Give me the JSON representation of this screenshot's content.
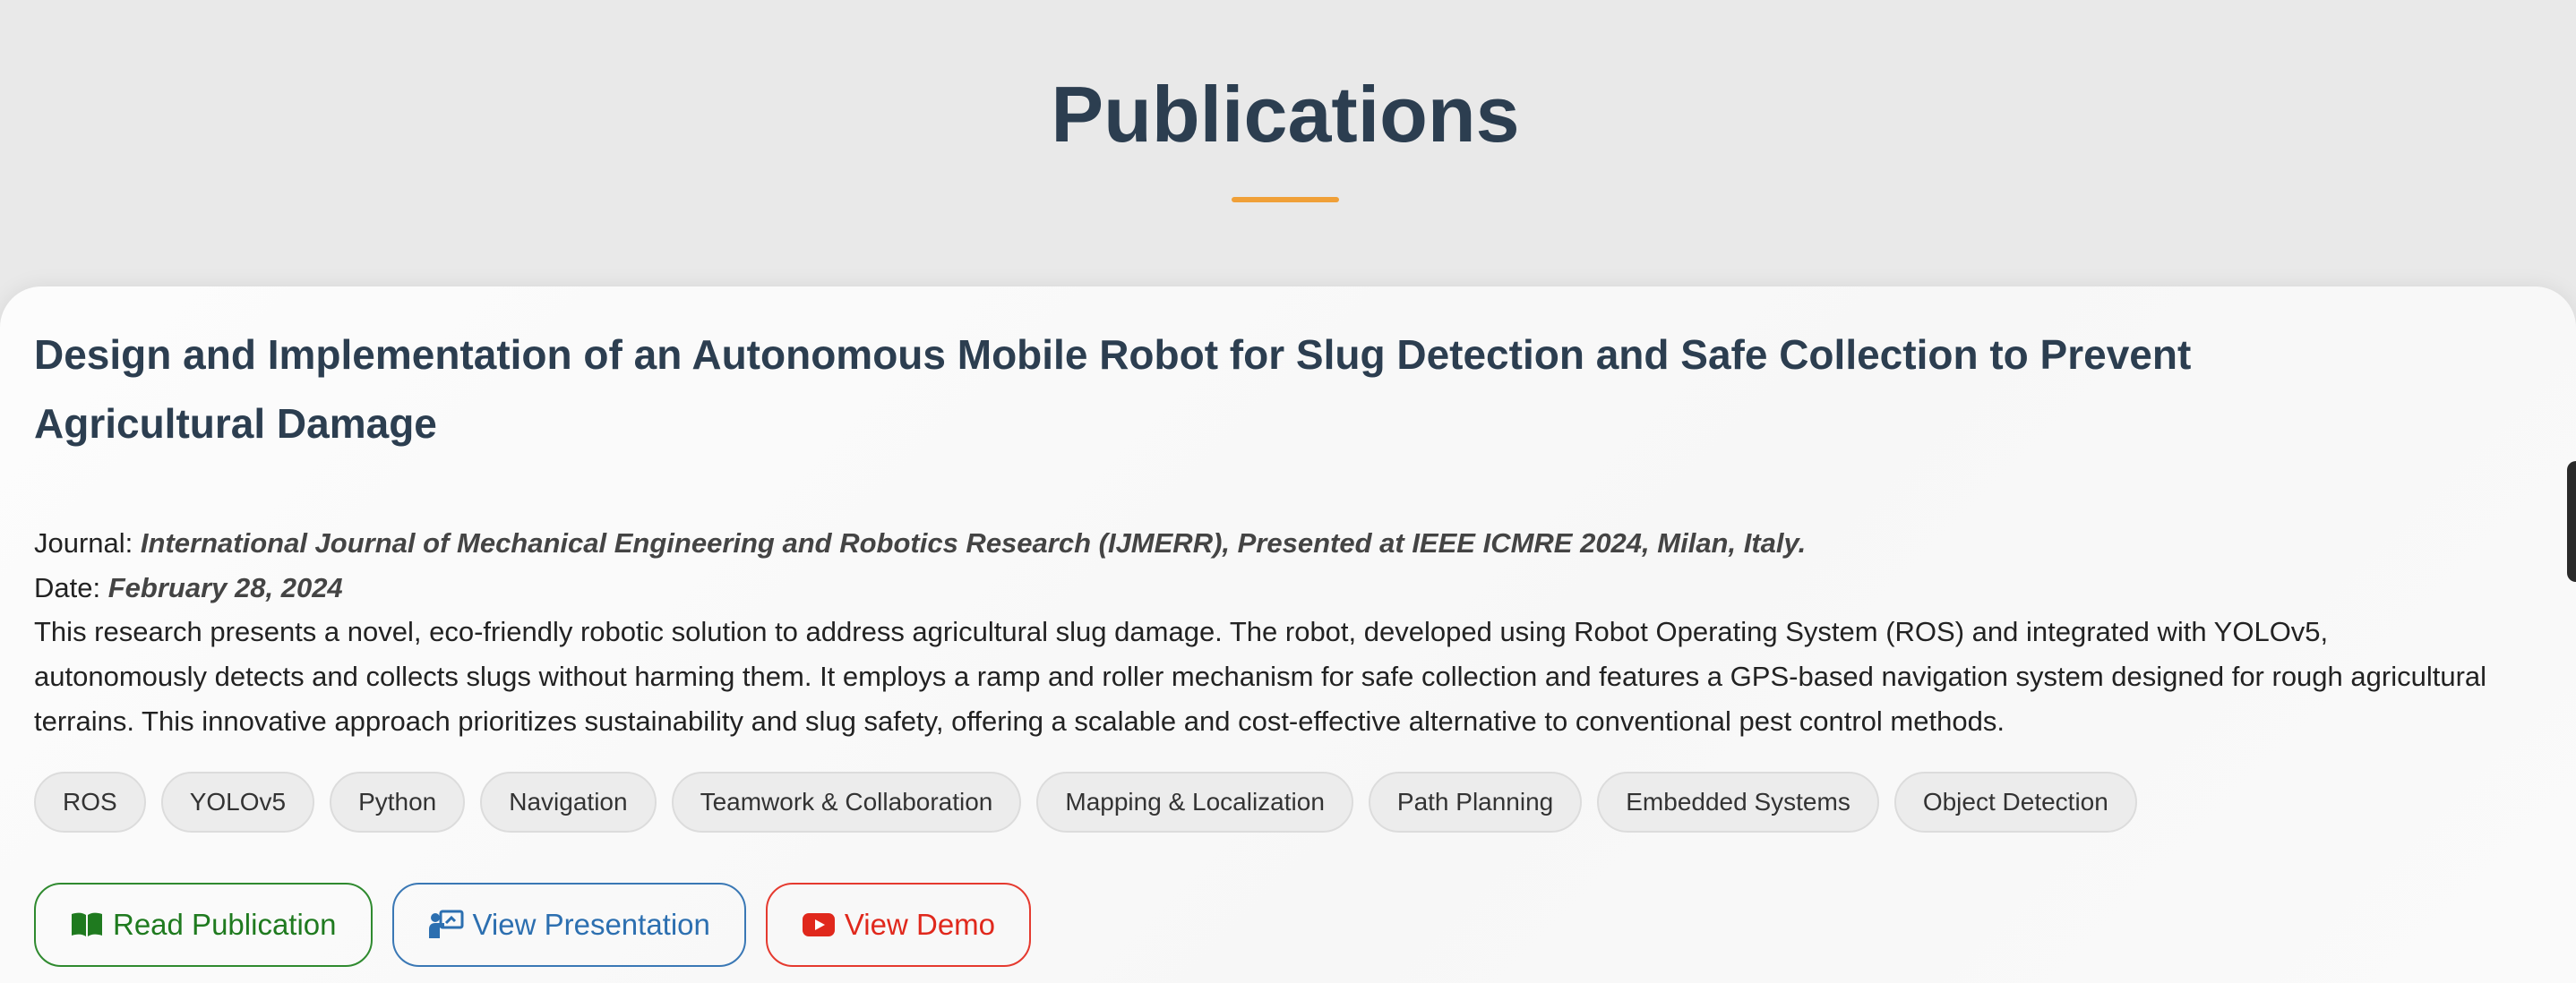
{
  "section": {
    "title": "Publications"
  },
  "publication": {
    "title": "Design and Implementation of an Autonomous Mobile Robot for Slug Detection and Safe Collection to Prevent Agricultural Damage",
    "journal_label": "Journal:",
    "journal_value": "International Journal of Mechanical Engineering and Robotics Research (IJMERR), Presented at IEEE ICMRE 2024, Milan, Italy.",
    "date_label": "Date:",
    "date_value": "February 28, 2024",
    "description": "This research presents a novel, eco-friendly robotic solution to address agricultural slug damage. The robot, developed using Robot Operating System (ROS) and integrated with YOLOv5, autonomously detects and collects slugs without harming them. It employs a ramp and roller mechanism for safe collection and features a GPS-based navigation system designed for rough agricultural terrains. This innovative approach prioritizes sustainability and slug safety, offering a scalable and cost-effective alternative to conventional pest control methods.",
    "tags": [
      "ROS",
      "YOLOv5",
      "Python",
      "Navigation",
      "Teamwork & Collaboration",
      "Mapping & Localization",
      "Path Planning",
      "Embedded Systems",
      "Object Detection"
    ],
    "buttons": {
      "read": {
        "label": "Read Publication",
        "icon": "book-open-icon",
        "color": "#1f7a1f"
      },
      "presentation": {
        "label": "View Presentation",
        "icon": "presentation-icon",
        "color": "#2c6fb0"
      },
      "demo": {
        "label": "View Demo",
        "icon": "youtube-icon",
        "color": "#e0281c"
      }
    }
  },
  "colors": {
    "background": "#e9e9e9",
    "heading": "#2c3e50",
    "accent_underline": "#f0a038",
    "card": "#fafafa"
  }
}
